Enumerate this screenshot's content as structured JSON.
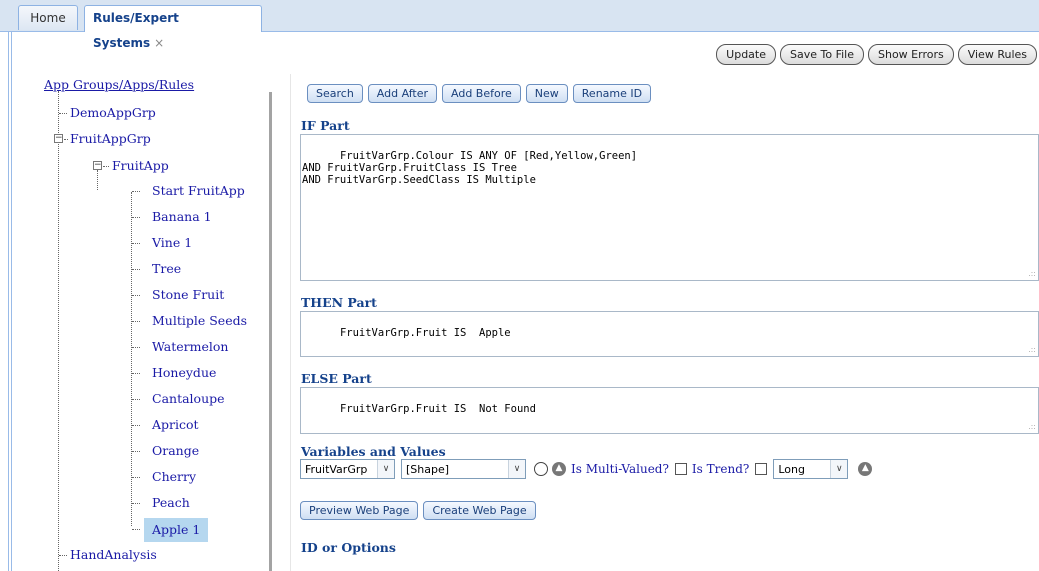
{
  "tabs": {
    "home": "Home",
    "active": "Rules/Expert Systems",
    "close": "×"
  },
  "toolbar": {
    "update": "Update",
    "save_to_file": "Save To File",
    "show_errors": "Show Errors",
    "view_rules": "View Rules"
  },
  "tree": {
    "root": "App Groups/Apps/Rules",
    "groups": [
      {
        "label": "DemoAppGrp"
      },
      {
        "label": "FruitAppGrp"
      },
      {
        "label": "HandAnalysis"
      }
    ],
    "app": "FruitApp",
    "rules": [
      "Start FruitApp",
      "Banana 1",
      "Vine 1",
      "Tree",
      "Stone Fruit",
      "Multiple Seeds",
      "Watermelon",
      "Honeydue",
      "Cantaloupe",
      "Apricot",
      "Orange",
      "Cherry",
      "Peach",
      "Apple 1"
    ],
    "selected_rule": "Apple 1"
  },
  "actions": {
    "search": "Search",
    "add_after": "Add After",
    "add_before": "Add Before",
    "new": "New",
    "rename_id": "Rename ID"
  },
  "if_part": {
    "label": "IF Part",
    "text": "FruitVarGrp.Colour IS ANY OF [Red,Yellow,Green]\nAND FruitVarGrp.FruitClass IS Tree\nAND FruitVarGrp.SeedClass IS Multiple"
  },
  "then_part": {
    "label": "THEN Part",
    "text": "FruitVarGrp.Fruit IS  Apple"
  },
  "else_part": {
    "label": "ELSE Part",
    "text": "FruitVarGrp.Fruit IS  Not Found"
  },
  "variables": {
    "label": "Variables and Values",
    "group_select": "FruitVarGrp",
    "variable_select": "[Shape]",
    "multi_valued_label": "Is Multi-Valued?",
    "trend_label": "Is Trend?",
    "type_select": "Long"
  },
  "web": {
    "preview": "Preview Web Page",
    "create": "Create Web Page"
  },
  "id_options": {
    "label": "ID or Options"
  }
}
